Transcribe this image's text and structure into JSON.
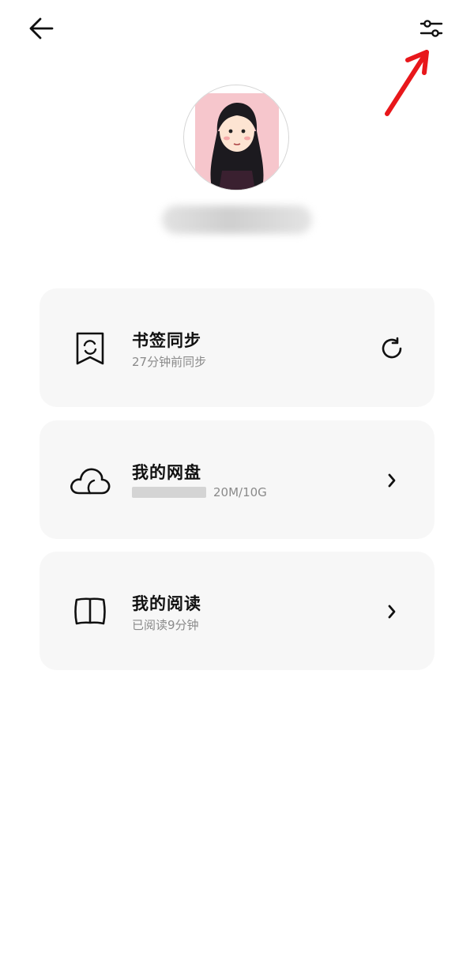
{
  "header": {
    "back_icon": "arrow-left-icon",
    "settings_icon": "sliders-icon"
  },
  "profile": {
    "avatar": "user-avatar"
  },
  "cards": {
    "bookmark_sync": {
      "title": "书签同步",
      "subtitle": "27分钟前同步",
      "icon": "bookmark-sync-icon",
      "action_icon": "refresh-icon"
    },
    "cloud_drive": {
      "title": "我的网盘",
      "usage_text": "20M/10G",
      "icon": "cloud-icon",
      "action_icon": "chevron-right-icon"
    },
    "my_reading": {
      "title": "我的阅读",
      "subtitle": "已阅读9分钟",
      "icon": "book-icon",
      "action_icon": "chevron-right-icon"
    }
  },
  "colors": {
    "card_background": "#f7f7f7",
    "secondary_text": "#8a8a8a",
    "annotation_arrow": "#e8171b"
  }
}
